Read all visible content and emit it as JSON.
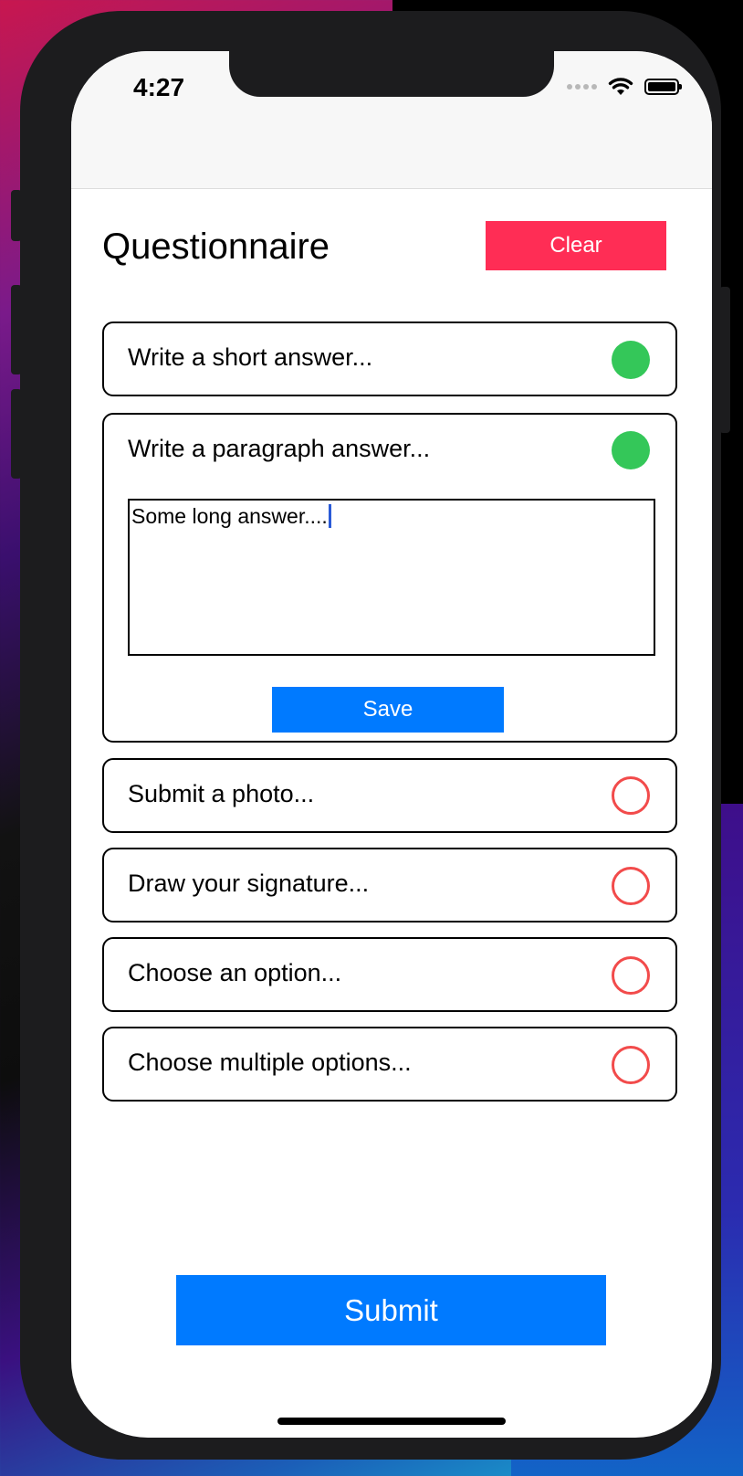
{
  "status_bar": {
    "time": "4:27"
  },
  "header": {
    "title": "Questionnaire",
    "clear_label": "Clear"
  },
  "questions": [
    {
      "label": "Write a short answer...",
      "status": "complete"
    },
    {
      "label": "Write a paragraph answer...",
      "status": "complete",
      "answer_value": "Some long answer....",
      "save_label": "Save"
    },
    {
      "label": "Submit a photo...",
      "status": "incomplete"
    },
    {
      "label": "Draw your signature...",
      "status": "incomplete"
    },
    {
      "label": "Choose an option...",
      "status": "incomplete"
    },
    {
      "label": "Choose multiple options...",
      "status": "incomplete"
    }
  ],
  "submit_label": "Submit",
  "colors": {
    "complete": "#34c759",
    "incomplete": "#f24b4b",
    "primary_button": "#007aff",
    "clear_button": "#ff2d55"
  }
}
